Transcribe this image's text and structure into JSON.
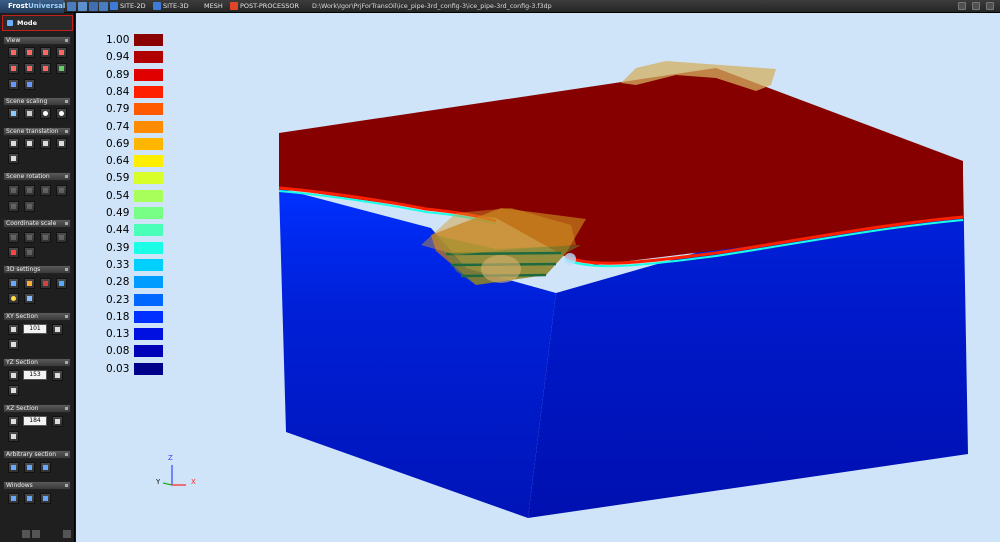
{
  "app": {
    "logo_prefix": "Frost",
    "logo_suffix": "Universal"
  },
  "tabs": [
    {
      "label": "SITE-2D",
      "icon": "site-2d-icon",
      "color": "#3e7bd6"
    },
    {
      "label": "SITE-3D",
      "icon": "site-3d-icon",
      "color": "#3e7bd6"
    },
    {
      "label": "MESH",
      "icon": "mesh-icon",
      "color": "#8a8a8a"
    },
    {
      "label": "POST-PROCESSOR",
      "icon": "post-processor-icon",
      "color": "#e0452a"
    }
  ],
  "file_path": "D:\\Work\\Igor\\PrjForTransOil\\ice_pipe-3rd_config-3\\ice_pipe-3rd_config-3.f3dp",
  "sidebar": {
    "mode_label": "Mode",
    "sections": [
      "View",
      "Scene scaling",
      "Scene translation",
      "Scene rotation",
      "Coordinate scale",
      "3D settings",
      "XY Section",
      "YZ Section",
      "XZ Section",
      "Arbitrary section",
      "Windows"
    ],
    "xy_value": "101",
    "yz_value": "153",
    "xz_value": "184"
  },
  "legend": [
    {
      "value": "1.00",
      "color": "#8b0000"
    },
    {
      "value": "0.94",
      "color": "#b00000"
    },
    {
      "value": "0.89",
      "color": "#e00000"
    },
    {
      "value": "0.84",
      "color": "#ff2000"
    },
    {
      "value": "0.79",
      "color": "#ff5a00"
    },
    {
      "value": "0.74",
      "color": "#ff8c00"
    },
    {
      "value": "0.69",
      "color": "#ffb600"
    },
    {
      "value": "0.64",
      "color": "#ffee00"
    },
    {
      "value": "0.59",
      "color": "#d8ff2a"
    },
    {
      "value": "0.54",
      "color": "#a8ff5a"
    },
    {
      "value": "0.49",
      "color": "#78ff86"
    },
    {
      "value": "0.44",
      "color": "#4affb8"
    },
    {
      "value": "0.39",
      "color": "#1affe6"
    },
    {
      "value": "0.33",
      "color": "#00d0ff"
    },
    {
      "value": "0.28",
      "color": "#009cff"
    },
    {
      "value": "0.23",
      "color": "#0068ff"
    },
    {
      "value": "0.18",
      "color": "#0030ff"
    },
    {
      "value": "0.13",
      "color": "#0010e0"
    },
    {
      "value": "0.08",
      "color": "#0000b8"
    },
    {
      "value": "0.03",
      "color": "#00008a"
    }
  ],
  "triad": {
    "z": "Z",
    "y": "Y",
    "x": "X"
  }
}
